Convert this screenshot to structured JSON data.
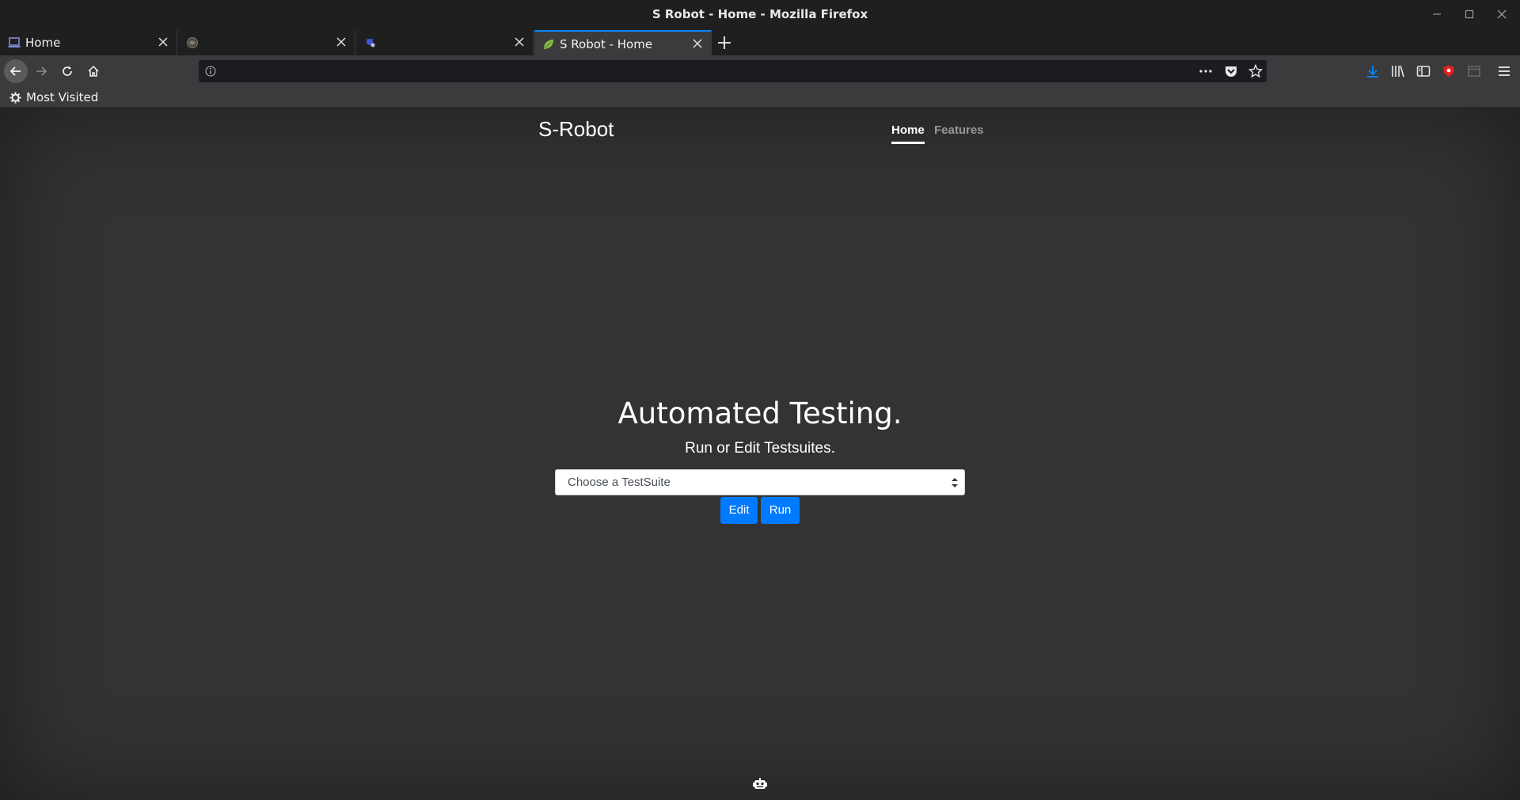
{
  "window": {
    "title": "S Robot - Home - Mozilla Firefox"
  },
  "tabs": [
    {
      "label": "Home",
      "favicon": "laptop-icon"
    },
    {
      "label": "",
      "favicon": "globe-icon"
    },
    {
      "label": "",
      "favicon": "bug-icon"
    },
    {
      "label": "S Robot - Home",
      "favicon": "leaf-icon",
      "active": true
    }
  ],
  "urlbar": {
    "url": ""
  },
  "bookmarks": {
    "most_visited": "Most Visited"
  },
  "page": {
    "brand": "S-Robot",
    "nav": {
      "home": "Home",
      "features": "Features"
    },
    "hero_title": "Automated Testing.",
    "hero_subtitle": "Run or Edit Testsuites.",
    "select": {
      "selected": "Choose a TestSuite"
    },
    "buttons": {
      "edit": "Edit",
      "run": "Run"
    }
  },
  "colors": {
    "accent": "#007bff",
    "tab_highlight": "#0a84ff",
    "background": "#333333"
  }
}
